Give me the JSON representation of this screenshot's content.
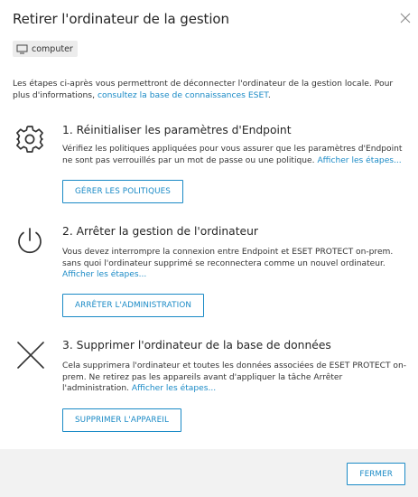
{
  "dialog": {
    "title": "Retirer l'ordinateur de la gestion",
    "chip_label": "computer",
    "intro_text": "Les étapes ci-après vous permettront de déconnecter l'ordinateur de la gestion locale. Pour plus d'informations, ",
    "intro_link": "consultez la base de connaissances ESET",
    "intro_end": "."
  },
  "steps": [
    {
      "title": "1. Réinitialiser les paramètres d'Endpoint",
      "desc": "Vérifiez les politiques appliquées pour vous assurer que les paramètres d'Endpoint ne sont pas verrouillés par un mot de passe ou une politique. ",
      "link": "Afficher les étapes...",
      "button": "GÉRER LES POLITIQUES",
      "icon": "gear-icon"
    },
    {
      "title": "2. Arrêter la gestion de l'ordinateur",
      "desc": "Vous devez interrompre la connexion entre Endpoint et ESET PROTECT on-prem. sans quoi l'ordinateur supprimé se reconnectera comme un nouvel ordinateur. ",
      "link": "Afficher les étapes...",
      "button": "ARRÊTER L'ADMINISTRATION",
      "icon": "power-icon"
    },
    {
      "title": "3. Supprimer l'ordinateur de la base de données",
      "desc": "Cela supprimera l'ordinateur et toutes les données associées de ESET PROTECT on-prem. Ne retirez pas les appareils avant d'appliquer la tâche Arrêter l'administration. ",
      "link": "Afficher les étapes...",
      "button": "SUPPRIMER L'APPAREIL",
      "icon": "x-icon"
    }
  ],
  "footer": {
    "close_button": "FERMER"
  },
  "colors": {
    "accent": "#1a8ac6",
    "footer_bg": "#f2f2f2",
    "chip_bg": "#ececec"
  }
}
